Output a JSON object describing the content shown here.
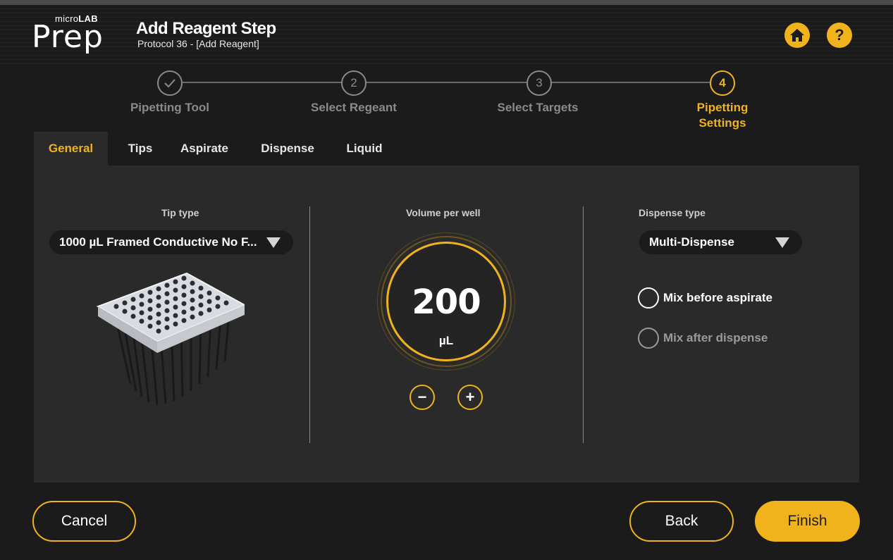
{
  "app": {
    "logo_micro": "micro",
    "logo_lab": "LAB",
    "logo_prep": "Prep"
  },
  "header": {
    "title": "Add Reagent Step",
    "subtitle": "Protocol 36 - [Add Reagent]",
    "home_icon": "home-icon",
    "help_label": "?"
  },
  "stepper": {
    "steps": [
      {
        "number": "",
        "label": "Pipetting Tool",
        "state": "completed"
      },
      {
        "number": "2",
        "label": "Select Regeant",
        "state": "pending"
      },
      {
        "number": "3",
        "label": "Select Targets",
        "state": "pending"
      },
      {
        "number": "4",
        "label_line1": "Pipetting",
        "label_line2": "Settings",
        "state": "active"
      }
    ]
  },
  "tabs": [
    {
      "label": "General",
      "active": true
    },
    {
      "label": "Tips",
      "active": false
    },
    {
      "label": "Aspirate",
      "active": false
    },
    {
      "label": "Dispense",
      "active": false
    },
    {
      "label": "Liquid",
      "active": false
    }
  ],
  "general": {
    "tip_type": {
      "label": "Tip type",
      "value": "1000 µL Framed Conductive No F..."
    },
    "volume": {
      "label": "Volume per well",
      "value": "200",
      "unit": "µL",
      "decrement": "−",
      "increment": "+"
    },
    "dispense_type": {
      "label": "Dispense type",
      "value": "Multi-Dispense"
    },
    "options": [
      {
        "label": "Mix before aspirate",
        "enabled": true,
        "checked": false
      },
      {
        "label": "Mix after dispense",
        "enabled": false,
        "checked": false
      }
    ]
  },
  "footer": {
    "cancel_label": "Cancel",
    "back_label": "Back",
    "finish_label": "Finish"
  },
  "colors": {
    "accent": "#f0b31c",
    "background": "#1b1b1b",
    "panel": "#2a2a2a",
    "muted": "#8a8a8a"
  }
}
